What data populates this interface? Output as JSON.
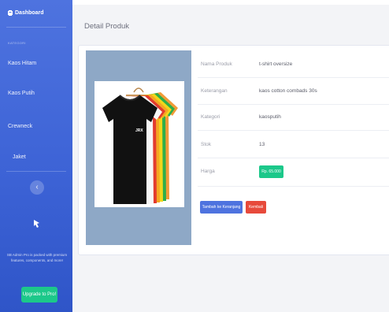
{
  "sidebar": {
    "brand": "Dashboard",
    "heading": "KATEGORI",
    "items": [
      {
        "label": "Kaos Hitam"
      },
      {
        "label": "Kaos Putih"
      },
      {
        "label": "Crewneck"
      },
      {
        "label": "Jaket"
      }
    ],
    "toggle_glyph": "‹",
    "promo_text": "SB Admin Pro is packed with premium features, components, and more!",
    "upgrade_label": "Upgrade to Pro!"
  },
  "main": {
    "title": "Detail Produk",
    "product": {
      "image_alt": "t-shirt oversize",
      "shirt_print": "JRX",
      "fields": [
        {
          "label": "Nama Produk",
          "value": "t-shirt oversize"
        },
        {
          "label": "Keterangan",
          "value": "kaos cotton combads 30s"
        },
        {
          "label": "Kategori",
          "value": "kaosputih"
        },
        {
          "label": "Stok",
          "value": "13"
        }
      ],
      "price_label": "Harga",
      "price_value": "Rp. 65.000"
    },
    "actions": {
      "add_to_cart": "Tambah ke Keranjang",
      "back": "Kembali"
    }
  },
  "colors": {
    "sidebar": "#4e73df",
    "success": "#1cc88a",
    "danger": "#e74a3b",
    "primary": "#4e73df",
    "shirt_colors": [
      "#111111",
      "#e23b2e",
      "#f5a623",
      "#f2d61b",
      "#2fae4a",
      "#f29b37"
    ]
  }
}
